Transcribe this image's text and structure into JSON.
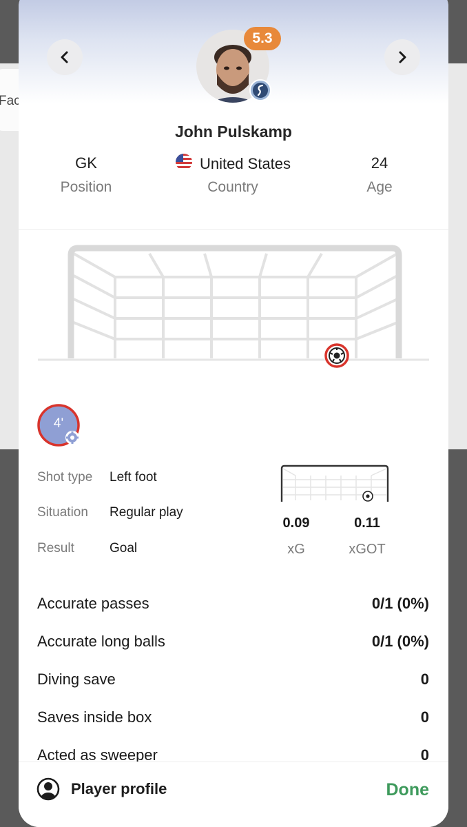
{
  "background": {
    "partial_text": "Fac"
  },
  "player": {
    "name": "John Pulskamp",
    "rating": "5.3",
    "position_value": "GK",
    "position_label": "Position",
    "country_value": "United States",
    "country_label": "Country",
    "age_value": "24",
    "age_label": "Age"
  },
  "shot": {
    "minute": "4'",
    "details": [
      {
        "label": "Shot type",
        "value": "Left foot"
      },
      {
        "label": "Situation",
        "value": "Regular play"
      },
      {
        "label": "Result",
        "value": "Goal"
      }
    ],
    "xg_value": "0.09",
    "xg_label": "xG",
    "xgot_value": "0.11",
    "xgot_label": "xGOT"
  },
  "stats": [
    {
      "label": "Accurate passes",
      "value": "0/1 (0%)"
    },
    {
      "label": "Accurate long balls",
      "value": "0/1 (0%)"
    },
    {
      "label": "Diving save",
      "value": "0"
    },
    {
      "label": "Saves inside box",
      "value": "0"
    },
    {
      "label": "Acted as sweeper",
      "value": "0"
    }
  ],
  "footer": {
    "profile_label": "Player profile",
    "done_label": "Done"
  },
  "colors": {
    "rating_badge": "#e8893a",
    "done_accent": "#3e9a5c",
    "minute_circle": "#8f9fd4",
    "shot_ring": "#d8342c"
  },
  "icons": [
    "chevron-left-icon",
    "chevron-right-icon",
    "team-crest-icon",
    "us-flag-icon",
    "soccer-ball-icon",
    "settings-gear-icon",
    "user-circle-icon"
  ]
}
